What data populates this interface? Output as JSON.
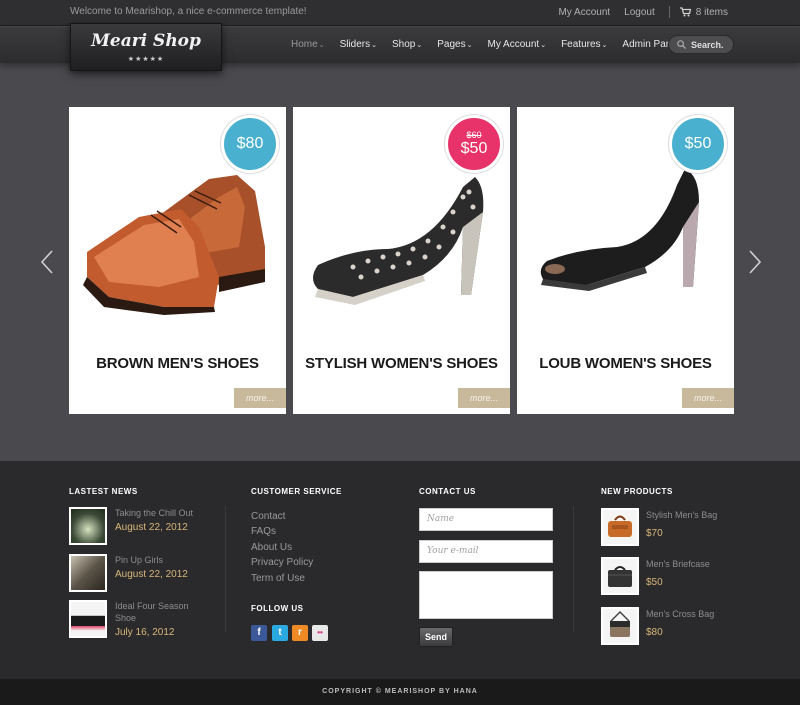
{
  "header": {
    "welcome": "Welcome to Mearishop, a nice e-commerce template!",
    "my_account": "My Account",
    "logout": "Logout",
    "cart_label": "8 items",
    "cart_icon": "cart-icon"
  },
  "logo": {
    "text": "Meari Shop",
    "stars": "★★★★★"
  },
  "nav": {
    "items": [
      {
        "label": "Home"
      },
      {
        "label": "Sliders"
      },
      {
        "label": "Shop"
      },
      {
        "label": "Pages"
      },
      {
        "label": "My Account"
      },
      {
        "label": "Features"
      },
      {
        "label": "Admin Panel"
      }
    ],
    "caret": "⌄",
    "search_label": "Search.",
    "search_icon": "search-icon"
  },
  "slider": {
    "prev_icon": "chevron-left-icon",
    "next_icon": "chevron-right-icon",
    "products": [
      {
        "title": "BROWN MEN'S SHOES",
        "price": "$80",
        "old_price": "",
        "badge_color": "#4ab0cf",
        "more": "more..."
      },
      {
        "title": "STYLISH WOMEN'S SHOES",
        "price": "$50",
        "old_price": "$60",
        "badge_color": "#e7336a",
        "more": "more..."
      },
      {
        "title": "LOUB WOMEN'S SHOES",
        "price": "$50",
        "old_price": "",
        "badge_color": "#4ab0cf",
        "more": "more..."
      }
    ]
  },
  "footer": {
    "news": {
      "title": "LASTEST NEWS",
      "items": [
        {
          "title": "Taking the Chill Out",
          "date": "August 22, 2012"
        },
        {
          "title": "Pin Up Girls",
          "date": "August 22, 2012"
        },
        {
          "title": "Ideal Four Season Shoe",
          "date": "July 16, 2012"
        }
      ]
    },
    "customer_service": {
      "title": "CUSTOMER SERVICE",
      "links": [
        "Contact",
        "FAQs",
        "About Us",
        "Privacy Policy",
        "Term of Use"
      ],
      "follow_title": "FOLLOW US",
      "social": [
        {
          "name": "facebook-icon",
          "glyph": "f",
          "color": "#3b5998"
        },
        {
          "name": "twitter-icon",
          "glyph": "t",
          "color": "#2aa9e0"
        },
        {
          "name": "rss-icon",
          "glyph": "r",
          "color": "#f08a24"
        },
        {
          "name": "flickr-icon",
          "glyph": "••",
          "color": "#e9e9e9"
        }
      ]
    },
    "contact": {
      "title": "CONTACT US",
      "name_placeholder": "Name",
      "email_placeholder": "Your e-mail",
      "send_label": "Send"
    },
    "new_products": {
      "title": "NEW PRODUCTS",
      "items": [
        {
          "name": "Stylish Men's Bag",
          "price": "$70"
        },
        {
          "name": "Men's Briefcase",
          "price": "$50"
        },
        {
          "name": "Men's Cross Bag",
          "price": "$80"
        }
      ]
    },
    "copyright": "COPYRIGHT © MEARISHOP BY HANA"
  }
}
